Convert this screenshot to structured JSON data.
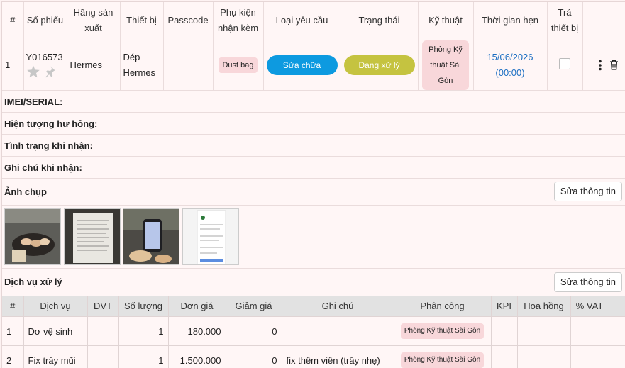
{
  "main_table": {
    "headers": [
      "#",
      "Số phiếu",
      "Hãng sản xuất",
      "Thiết bị",
      "Passcode",
      "Phụ kiện nhận kèm",
      "Loại yêu cầu",
      "Trạng thái",
      "Kỹ thuật",
      "Thời gian hẹn",
      "Trả thiết bị"
    ],
    "row": {
      "index": "1",
      "ticket_no": "Y016573",
      "brand": "Hermes",
      "device": "Dép Hermes",
      "passcode": "",
      "accessory": "Dust bag",
      "request_type": "Sửa chữa",
      "status": "Đang xử lý",
      "technician": "Phòng Kỹ thuật Sài Gòn",
      "appointment_date": "15/06/2026",
      "appointment_time": "(00:00)"
    }
  },
  "info_fields": {
    "imei": "IMEI/SERIAL:",
    "damage": "Hiện tượng hư hỏng:",
    "condition": "Tình trạng khi nhận:",
    "note": "Ghi chú khi nhận:"
  },
  "photos_section": {
    "title": "Ảnh chụp",
    "edit_label": "Sửa thông tin"
  },
  "service_section": {
    "title": "Dịch vụ xử lý",
    "edit_label": "Sửa thông tin",
    "headers": [
      "#",
      "Dịch vụ",
      "ĐVT",
      "Số lượng",
      "Đơn giá",
      "Giảm giá",
      "Ghi chú",
      "Phân công",
      "KPI",
      "Hoa hồng",
      "% VAT"
    ],
    "rows": [
      {
        "index": "1",
        "service": "Dơ vệ sinh",
        "unit": "",
        "qty": "1",
        "price": "180.000",
        "discount": "0",
        "note": "",
        "assignee": "Phòng Kỹ thuật Sài Gòn",
        "kpi": "",
        "commission": "",
        "vat": ""
      },
      {
        "index": "2",
        "service": "Fix trầy mũi",
        "unit": "",
        "qty": "1",
        "price": "1.500.000",
        "discount": "0",
        "note": "fix thêm viền (trầy nhẹ)",
        "assignee": "Phòng Kỹ thuật Sài Gòn",
        "kpi": "",
        "commission": "",
        "vat": ""
      }
    ]
  },
  "icons": {
    "star": "star-icon",
    "pin": "pin-icon",
    "more": "more-vertical-icon",
    "delete": "trash-icon"
  },
  "colors": {
    "request_type": "#0d9ae0",
    "status": "#c5c340",
    "badge": "#f8d7da",
    "date": "#1b6ec2"
  }
}
